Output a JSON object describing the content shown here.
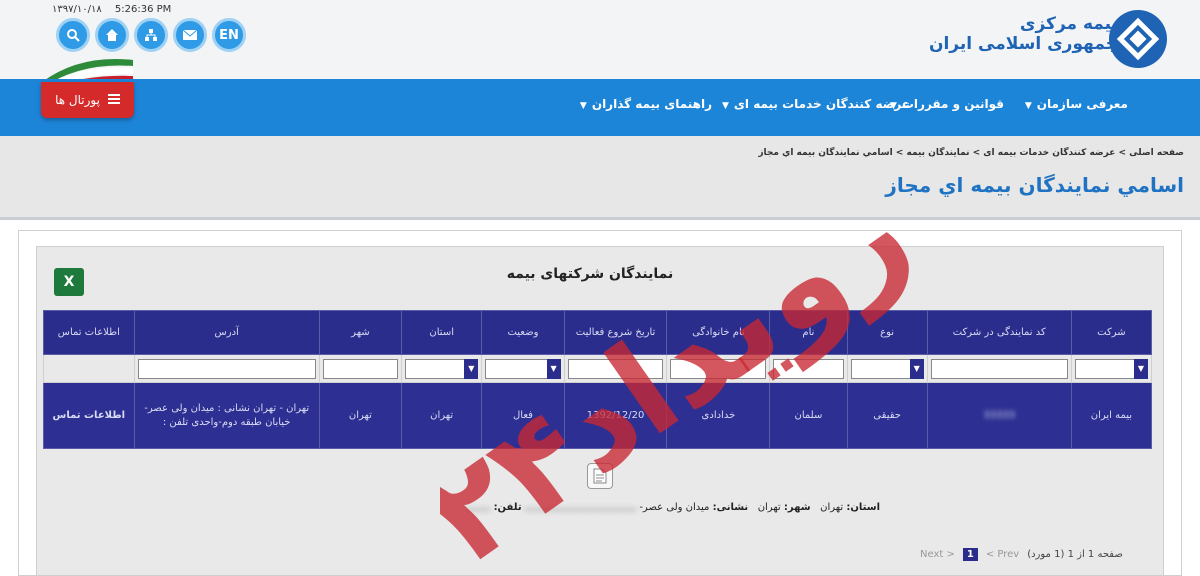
{
  "header": {
    "date": "۱۳۹۷/۱۰/۱۸",
    "time": "5:26:36 PM",
    "buttons": [
      {
        "name": "search-icon",
        "glyph": "🔍"
      },
      {
        "name": "home-icon",
        "glyph": "⌂"
      },
      {
        "name": "sitemap-icon",
        "glyph": "⊞"
      },
      {
        "name": "mail-icon",
        "glyph": "✉"
      },
      {
        "name": "language-en",
        "glyph": "EN"
      }
    ],
    "portal_label": "پورتال ها",
    "logo_line1": "بیمه مرکزی",
    "logo_line2": "جمهوری اسلامی ایران"
  },
  "nav": {
    "items": [
      "معرفی سازمان",
      "قوانین و مقررات",
      "عرضه کنندگان خدمات بیمه ای",
      "راهنمای بیمه گذاران"
    ]
  },
  "breadcrumb": "صفحه اصلی > عرضه کنندگان خدمات بیمه ای > نمایندگان بیمه > اسامي نمايندگان بيمه اي مجاز",
  "page_title": "اسامي نمايندگان بيمه اي مجاز",
  "table": {
    "title": "نمایندگان شرکتهای بیمه",
    "columns": [
      "شرکت",
      "کد نمایندگی در شرکت",
      "نوع",
      "نام",
      "نام خانوادگی",
      "تاریخ شروع فعالیت",
      "وضعیت",
      "استان",
      "شهر",
      "آدرس",
      "اطلاعات تماس"
    ],
    "row": {
      "company": "بیمه ایران",
      "code": "33333",
      "type": "حقیقی",
      "first_name": "سلمان",
      "last_name": "خدادادی",
      "start_date": "1392/12/20",
      "status": "فعال",
      "province": "تهران",
      "city": "تهران",
      "address": "تهران - تهران نشانی : میدان ولی عصر-خیابان طبقه دوم-واحدی تلفن :",
      "contact": "اطلاعات تماس"
    }
  },
  "detail": {
    "province_label": "استان:",
    "province": "تهران",
    "city_label": "شهر:",
    "city": "تهران",
    "address_label": "نشانی:",
    "address": "میدان ولی عصر-",
    "phone_label": "تلفن:"
  },
  "pager": {
    "summary": "صفحه 1 از 1 (1 مورد)",
    "prev": "< Prev",
    "current": "1",
    "next": "Next >"
  },
  "watermark": "رویداد۲۴",
  "colors": {
    "nav": "#1d85d8",
    "grid_header": "#2b2d8c",
    "title": "#1f73c2",
    "portal": "#d42a2a"
  }
}
